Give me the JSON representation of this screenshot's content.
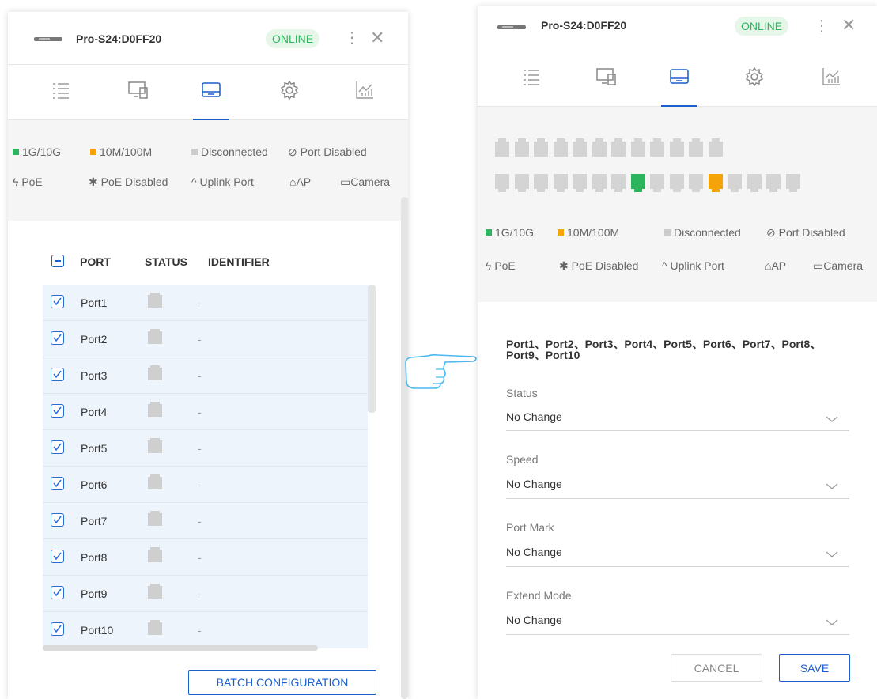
{
  "device": {
    "name": "Pro-S24:D0FF20",
    "status": "ONLINE"
  },
  "tabs": [
    {
      "icon": "list-icon"
    },
    {
      "icon": "monitor-icon"
    },
    {
      "icon": "switch-port-icon",
      "active": true
    },
    {
      "icon": "gear-icon"
    },
    {
      "icon": "chart-icon"
    }
  ],
  "legend": {
    "speed_1g": "1G/10G",
    "speed_100m": "10M/100M",
    "disconnected": "Disconnected",
    "port_disabled": "Port Disabled",
    "poe": "PoE",
    "poe_disabled": "PoE Disabled",
    "uplink": "Uplink Port",
    "ap": "AP",
    "camera": "Camera",
    "colors": {
      "speed_1g": "#2db55d",
      "speed_100m": "#f5a30a",
      "disconnected": "#cccccc"
    }
  },
  "port_table": {
    "headers": {
      "port": "PORT",
      "status": "STATUS",
      "identifier": "IDENTIFIER"
    },
    "rows": [
      {
        "port": "Port1",
        "identifier": "-",
        "checked": true
      },
      {
        "port": "Port2",
        "identifier": "-",
        "checked": true
      },
      {
        "port": "Port3",
        "identifier": "-",
        "checked": true
      },
      {
        "port": "Port4",
        "identifier": "-",
        "checked": true
      },
      {
        "port": "Port5",
        "identifier": "-",
        "checked": true
      },
      {
        "port": "Port6",
        "identifier": "-",
        "checked": true
      },
      {
        "port": "Port7",
        "identifier": "-",
        "checked": true
      },
      {
        "port": "Port8",
        "identifier": "-",
        "checked": true
      },
      {
        "port": "Port9",
        "identifier": "-",
        "checked": true
      },
      {
        "port": "Port10",
        "identifier": "-",
        "checked": true
      }
    ],
    "batch_button": "BATCH CONFIGURATION"
  },
  "panel_ports": {
    "top_row_count": 12,
    "bottom_row": [
      "gray",
      "gray",
      "gray",
      "gray",
      "gray",
      "gray",
      "gray",
      "green",
      "gray",
      "gray",
      "gray",
      "orange",
      "gray",
      "gray",
      "gray",
      "gray"
    ]
  },
  "batch_form": {
    "selected_ports": "Port1、Port2、Port3、Port4、Port5、Port6、Port7、Port8、Port9、Port10",
    "fields": [
      {
        "label": "Status",
        "value": "No Change"
      },
      {
        "label": "Speed",
        "value": "No Change"
      },
      {
        "label": "Port Mark",
        "value": "No Change"
      },
      {
        "label": "Extend Mode",
        "value": "No Change"
      }
    ],
    "cancel": "CANCEL",
    "save": "SAVE"
  },
  "pointer": {
    "icon": "pointing-hand-icon"
  }
}
